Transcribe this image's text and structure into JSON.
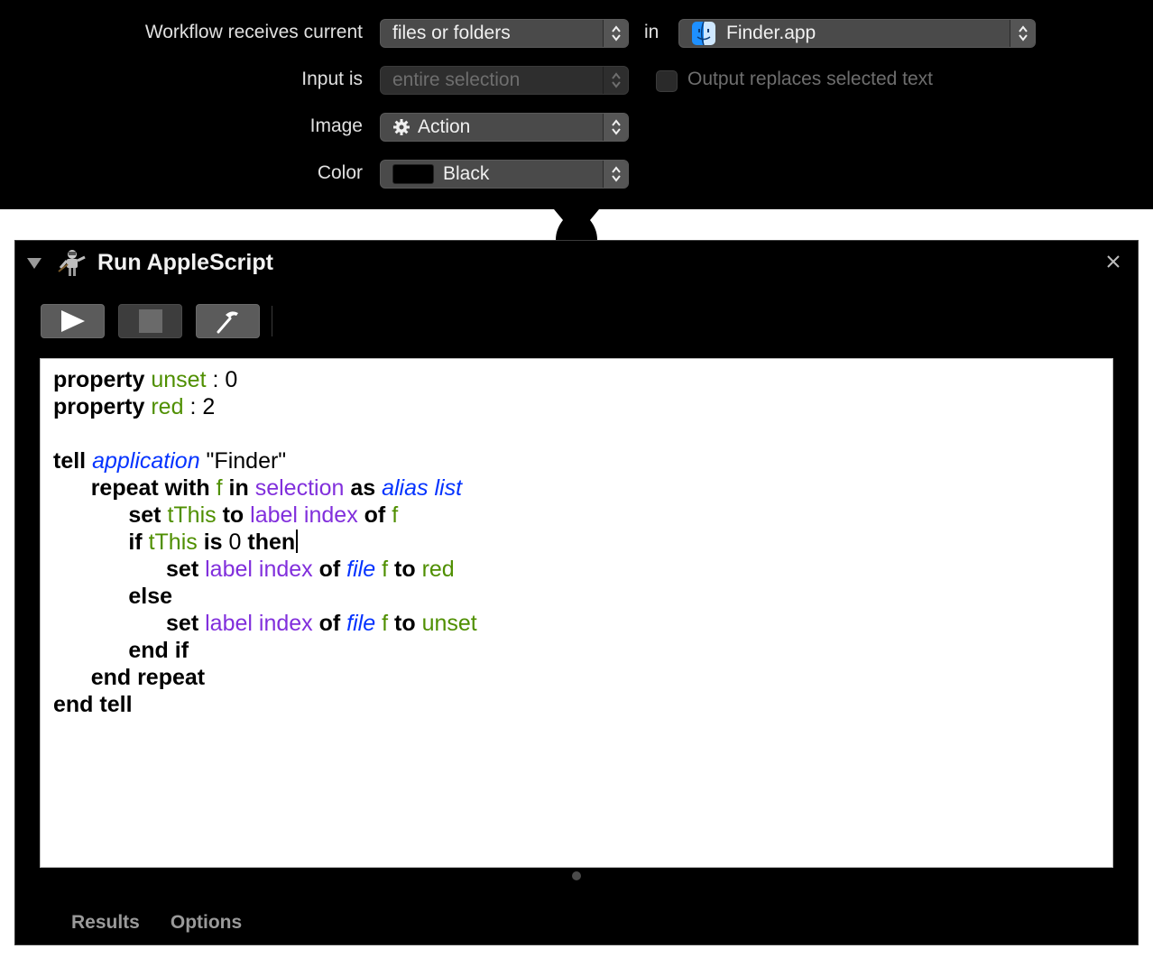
{
  "workflow": {
    "receives_label": "Workflow receives current",
    "receives_value": "files or folders",
    "in_label": "in",
    "app_value": "Finder.app",
    "input_label": "Input is",
    "input_value": "entire selection",
    "output_checkbox_label": "Output replaces selected text",
    "output_checked": false,
    "image_label": "Image",
    "image_value": "Action",
    "color_label": "Color",
    "color_value": "Black",
    "color_swatch": "#000000"
  },
  "action": {
    "title": "Run AppleScript",
    "icon": "automator-robot-icon",
    "toolbar": {
      "run": "play-icon",
      "stop": "stop-icon",
      "compile": "hammer-icon"
    },
    "script_lines": [
      [
        {
          "t": "property",
          "c": "kw"
        },
        {
          "t": " "
        },
        {
          "t": "unset",
          "c": "var"
        },
        {
          "t": " : 0"
        }
      ],
      [
        {
          "t": "property",
          "c": "kw"
        },
        {
          "t": " "
        },
        {
          "t": "red",
          "c": "var"
        },
        {
          "t": " : 2"
        }
      ],
      [],
      [
        {
          "t": "tell",
          "c": "kw"
        },
        {
          "t": " "
        },
        {
          "t": "application",
          "c": "cls"
        },
        {
          "t": " \"Finder\""
        }
      ],
      [
        {
          "t": "    "
        },
        {
          "t": "repeat with",
          "c": "kw"
        },
        {
          "t": " "
        },
        {
          "t": "f",
          "c": "var"
        },
        {
          "t": " "
        },
        {
          "t": "in",
          "c": "kw"
        },
        {
          "t": " "
        },
        {
          "t": "selection",
          "c": "prop"
        },
        {
          "t": " "
        },
        {
          "t": "as",
          "c": "kw"
        },
        {
          "t": " "
        },
        {
          "t": "alias list",
          "c": "cls"
        }
      ],
      [
        {
          "t": "        "
        },
        {
          "t": "set",
          "c": "kw"
        },
        {
          "t": " "
        },
        {
          "t": "tThis",
          "c": "var"
        },
        {
          "t": " "
        },
        {
          "t": "to",
          "c": "kw"
        },
        {
          "t": " "
        },
        {
          "t": "label index",
          "c": "prop"
        },
        {
          "t": " "
        },
        {
          "t": "of",
          "c": "kw"
        },
        {
          "t": " "
        },
        {
          "t": "f",
          "c": "var"
        }
      ],
      [
        {
          "t": "        "
        },
        {
          "t": "if",
          "c": "kw"
        },
        {
          "t": " "
        },
        {
          "t": "tThis",
          "c": "var"
        },
        {
          "t": " "
        },
        {
          "t": "is",
          "c": "kw"
        },
        {
          "t": " 0 "
        },
        {
          "t": "then",
          "c": "kw"
        },
        {
          "t": "",
          "c": "cursor"
        }
      ],
      [
        {
          "t": "            "
        },
        {
          "t": "set",
          "c": "kw"
        },
        {
          "t": " "
        },
        {
          "t": "label index",
          "c": "prop"
        },
        {
          "t": " "
        },
        {
          "t": "of",
          "c": "kw"
        },
        {
          "t": " "
        },
        {
          "t": "file",
          "c": "cls"
        },
        {
          "t": " "
        },
        {
          "t": "f",
          "c": "var"
        },
        {
          "t": " "
        },
        {
          "t": "to",
          "c": "kw"
        },
        {
          "t": " "
        },
        {
          "t": "red",
          "c": "var"
        }
      ],
      [
        {
          "t": "        "
        },
        {
          "t": "else",
          "c": "kw"
        }
      ],
      [
        {
          "t": "            "
        },
        {
          "t": "set",
          "c": "kw"
        },
        {
          "t": " "
        },
        {
          "t": "label index",
          "c": "prop"
        },
        {
          "t": " "
        },
        {
          "t": "of",
          "c": "kw"
        },
        {
          "t": " "
        },
        {
          "t": "file",
          "c": "cls"
        },
        {
          "t": " "
        },
        {
          "t": "f",
          "c": "var"
        },
        {
          "t": " "
        },
        {
          "t": "to",
          "c": "kw"
        },
        {
          "t": " "
        },
        {
          "t": "unset",
          "c": "var"
        }
      ],
      [
        {
          "t": "        "
        },
        {
          "t": "end if",
          "c": "kw"
        }
      ],
      [
        {
          "t": "    "
        },
        {
          "t": "end repeat",
          "c": "kw"
        }
      ],
      [
        {
          "t": "end tell",
          "c": "kw"
        }
      ]
    ],
    "tabs": [
      "Results",
      "Options"
    ]
  },
  "colors": {
    "keyword": "#000000",
    "variable": "#4f8f00",
    "property": "#812fdc",
    "class": "#0433ff"
  }
}
